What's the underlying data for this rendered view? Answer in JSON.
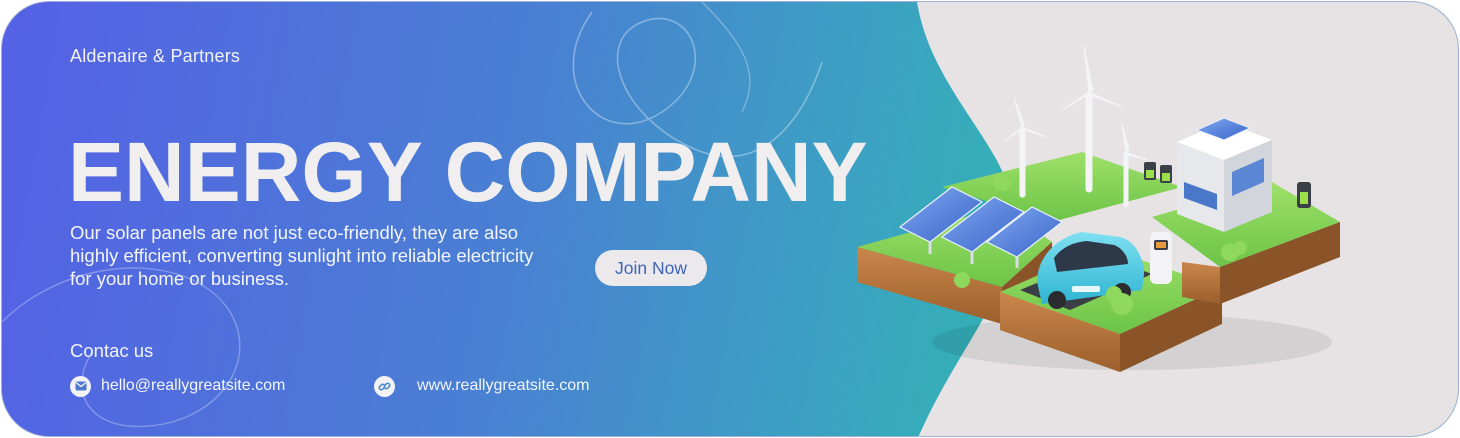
{
  "brand": {
    "name": "Aldenaire & Partners"
  },
  "hero": {
    "title": "ENERGY COMPANY",
    "description": "Our solar panels are not just eco-friendly, they are also highly efficient, converting sunlight into reliable electricity for your home or business.",
    "cta_label": "Join Now"
  },
  "contact": {
    "heading": "Contac us",
    "email": "hello@reallygreatsite.com",
    "website": "www.reallygreatsite.com",
    "email_icon": "mail-icon",
    "website_icon": "link-icon"
  },
  "colors": {
    "gradient_start": "#5560e6",
    "gradient_end": "#2bc3a0",
    "panel_bg": "#e7e3e4",
    "button_text": "#3f64b9"
  }
}
